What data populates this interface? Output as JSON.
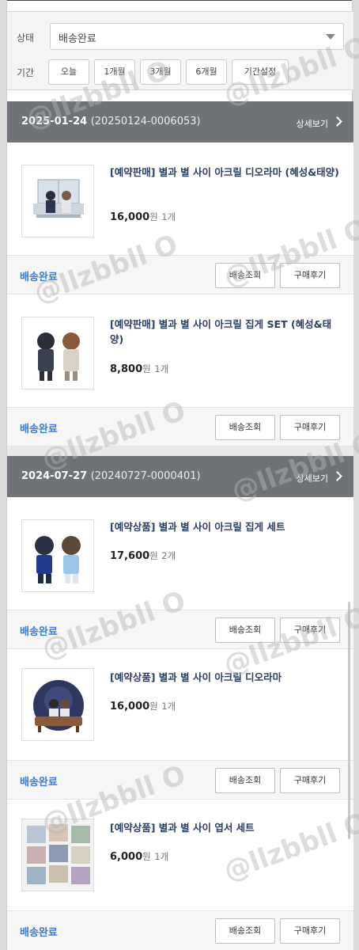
{
  "filter": {
    "status_label": "상태",
    "status_value": "배송완료",
    "period_label": "기간",
    "periods": [
      "오늘",
      "1개월",
      "3개월",
      "6개월",
      "기간설정"
    ]
  },
  "orders": [
    {
      "date": "2025-01-24",
      "order_no": "(20250124-0006053)",
      "detail_label": "상세보기",
      "items": [
        {
          "name": "[예약판매] 별과 별 사이 아크릴 디오라마 (혜성&태양)",
          "price": "16,000",
          "won": "원",
          "qty": "1개",
          "status": "배송완료",
          "track_label": "배송조회",
          "review_label": "구매후기"
        },
        {
          "name": "[예약판매] 별과 별 사이 아크릴 집게 SET (혜성&태양)",
          "price": "8,800",
          "won": "원",
          "qty": "1개",
          "status": "배송완료",
          "track_label": "배송조회",
          "review_label": "구매후기"
        }
      ]
    },
    {
      "date": "2024-07-27",
      "order_no": "(20240727-0000401)",
      "detail_label": "상세보기",
      "items": [
        {
          "name": "[예약상품] 별과 별 사이 아크릴 집게 세트",
          "price": "17,600",
          "won": "원",
          "qty": "2개",
          "status": "배송완료",
          "track_label": "배송조회",
          "review_label": "구매후기"
        },
        {
          "name": "[예약상품] 별과 별 사이 아크릴 디오라마",
          "price": "16,000",
          "won": "원",
          "qty": "1개",
          "status": "배송완료",
          "track_label": "배송조회",
          "review_label": "구매후기"
        },
        {
          "name": "[예약상품] 별과 별 사이 엽서 세트",
          "price": "6,000",
          "won": "원",
          "qty": "1개",
          "status": "배송완료",
          "track_label": "배송조회",
          "review_label": "구매후기"
        }
      ]
    }
  ],
  "watermark": "@llzbbll O",
  "colors": {
    "header_bg": "#6f7378",
    "status_blue": "#3a7bd5",
    "product_name": "#2d3e63"
  }
}
